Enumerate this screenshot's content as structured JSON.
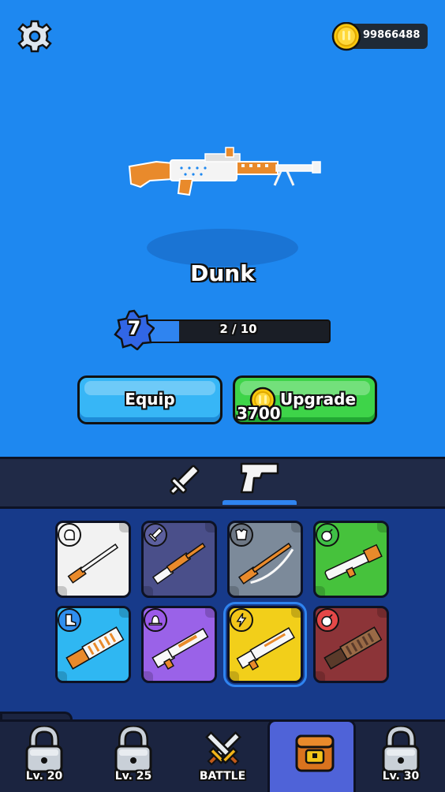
{
  "header": {
    "coins": "99866488"
  },
  "weapon": {
    "name": "Dunk",
    "level": "7",
    "progress_text": "2 / 10",
    "progress": 0.2
  },
  "actions": {
    "equip_label": "Equip",
    "upgrade_label": "Upgrade",
    "upgrade_cost": "3700"
  },
  "tabs": [
    {
      "name": "melee",
      "icon": "sword-icon",
      "selected": false
    },
    {
      "name": "guns",
      "icon": "pistol-icon",
      "selected": true
    }
  ],
  "weapons_grid": [
    {
      "rarity_icon": "fist-icon",
      "bg": "#f2f2f2",
      "selected": false
    },
    {
      "rarity_icon": "sword-icon",
      "bg": "#4a4f8a",
      "selected": false
    },
    {
      "rarity_icon": "armor-icon",
      "bg": "#7c8a9a",
      "selected": false
    },
    {
      "rarity_icon": "bomb-icon",
      "bg": "#46c23c",
      "selected": false
    },
    {
      "rarity_icon": "boot-icon",
      "bg": "#2fb7f2",
      "selected": false
    },
    {
      "rarity_icon": "hat-icon",
      "bg": "#9a62e8",
      "selected": false
    },
    {
      "rarity_icon": "lightning-icon",
      "bg": "#f2cf1a",
      "selected": true
    },
    {
      "rarity_icon": "bomb-icon",
      "bg": "#8c3438",
      "selected": false
    }
  ],
  "bottom_nav": [
    {
      "label": "Lv. 20",
      "icon": "lock-icon"
    },
    {
      "label": "Lv. 25",
      "icon": "lock-icon"
    },
    {
      "label": "BATTLE",
      "icon": "crossed-swords-icon"
    },
    {
      "label": "",
      "icon": "treasure-chest-icon",
      "selected": true
    },
    {
      "label": "Lv. 30",
      "icon": "lock-icon"
    }
  ]
}
